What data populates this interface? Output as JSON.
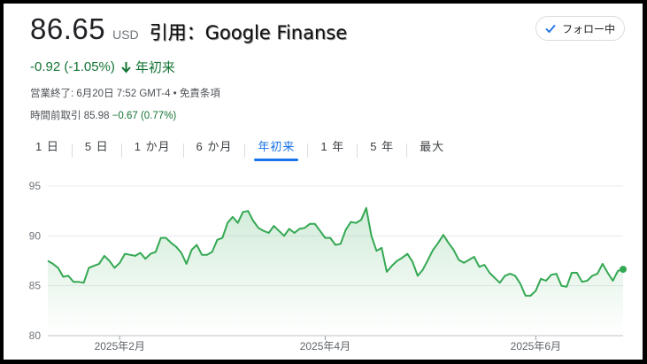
{
  "quote": {
    "price": "86.65",
    "currency": "USD",
    "source": "引用：Google Finanse",
    "change": "-0.92 (-1.05%)",
    "period_label": "年初来",
    "close_info": "営業終了: 6月20日 7:52 GMT-4 • 免責条項",
    "after_hours_label": "時間前取引",
    "after_hours_price": "85.98",
    "after_hours_change": "−0.67 (0.77%)"
  },
  "follow_button": {
    "label": "フォロー中"
  },
  "tabs": [
    {
      "label": "1 日",
      "active": false
    },
    {
      "label": "5 日",
      "active": false
    },
    {
      "label": "1 か月",
      "active": false
    },
    {
      "label": "6 か月",
      "active": false
    },
    {
      "label": "年初来",
      "active": true
    },
    {
      "label": "1 年",
      "active": false
    },
    {
      "label": "5 年",
      "active": false
    },
    {
      "label": "最大",
      "active": false
    }
  ],
  "colors": {
    "positive": "#137333",
    "accent": "#1a73e8",
    "line": "#34a853"
  },
  "chart_data": {
    "type": "area",
    "ylim": [
      80,
      95
    ],
    "yticks": [
      80,
      85,
      90,
      95
    ],
    "xticks": [
      {
        "label": "2025年2月",
        "index": 14
      },
      {
        "label": "2025年4月",
        "index": 54
      },
      {
        "label": "2025年6月",
        "index": 95
      }
    ],
    "grid": true,
    "series": [
      {
        "values": [
          87.5,
          87.2,
          86.8,
          85.9,
          86.0,
          85.4,
          85.4,
          85.3,
          86.8,
          87.0,
          87.2,
          88.0,
          87.5,
          86.8,
          87.3,
          88.2,
          88.1,
          88.0,
          88.3,
          87.7,
          88.2,
          88.4,
          89.8,
          89.8,
          89.3,
          88.9,
          88.3,
          87.2,
          88.6,
          89.1,
          88.1,
          88.1,
          88.4,
          89.6,
          89.8,
          91.3,
          91.9,
          91.3,
          92.4,
          92.5,
          91.5,
          90.8,
          90.5,
          90.3,
          91.0,
          90.5,
          90.0,
          90.7,
          90.3,
          90.7,
          90.8,
          91.2,
          91.2,
          90.5,
          89.8,
          89.8,
          89.1,
          89.2,
          90.6,
          91.4,
          91.3,
          91.6,
          92.8,
          90.0,
          88.5,
          88.8,
          86.4,
          87.0,
          87.5,
          87.8,
          88.2,
          87.4,
          86.0,
          86.6,
          87.6,
          88.6,
          89.3,
          90.1,
          89.3,
          88.6,
          87.6,
          87.3,
          87.6,
          87.9,
          86.9,
          87.1,
          86.3,
          85.8,
          85.3,
          86.0,
          86.2,
          86.0,
          85.2,
          84.0,
          84.0,
          84.5,
          85.7,
          85.5,
          86.1,
          86.2,
          85.0,
          84.9,
          86.3,
          86.3,
          85.4,
          85.5,
          86.0,
          86.2,
          87.2,
          86.3,
          85.5,
          86.5,
          86.65
        ]
      }
    ]
  }
}
